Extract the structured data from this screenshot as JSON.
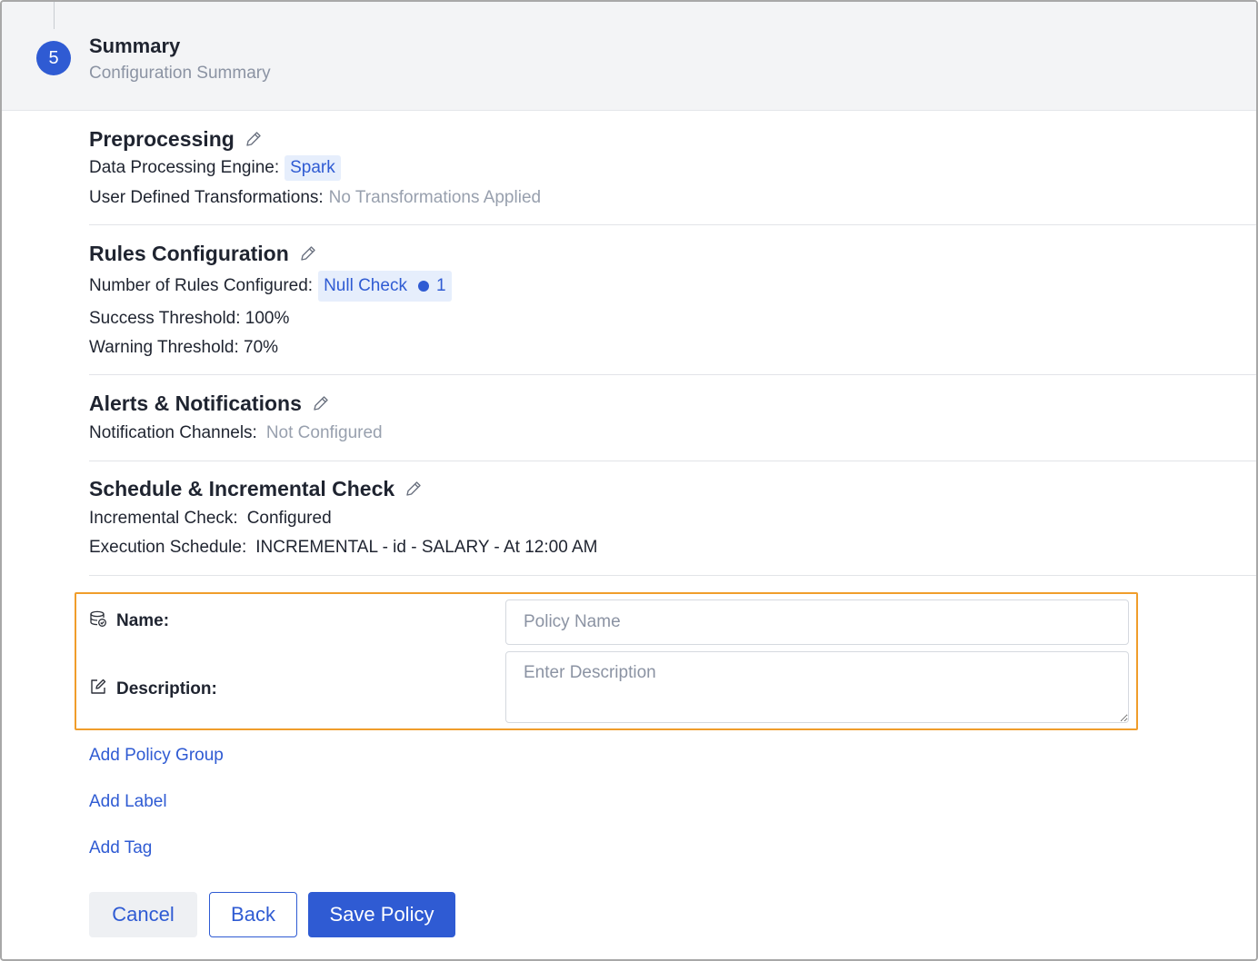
{
  "step": {
    "number": "5",
    "title": "Summary",
    "subtitle": "Configuration Summary"
  },
  "preprocessing": {
    "title": "Preprocessing",
    "engine_label": "Data Processing Engine:",
    "engine_value": "Spark",
    "udt_label": "User Defined Transformations:",
    "udt_value": "No Transformations Applied"
  },
  "rules": {
    "title": "Rules Configuration",
    "count_label": "Number of Rules Configured:",
    "rule_name": "Null Check",
    "rule_count": "1",
    "success_threshold": "Success Threshold: 100%",
    "warning_threshold": "Warning Threshold: 70%"
  },
  "alerts": {
    "title": "Alerts & Notifications",
    "channels_label": "Notification Channels:",
    "channels_value": "Not Configured"
  },
  "schedule": {
    "title": "Schedule & Incremental Check",
    "incremental_label": "Incremental Check:",
    "incremental_value": "Configured",
    "execution_label": "Execution Schedule:",
    "execution_value": "INCREMENTAL - id - SALARY - At 12:00 AM"
  },
  "form": {
    "name_label": "Name:",
    "name_placeholder": "Policy Name",
    "description_label": "Description:",
    "description_placeholder": "Enter Description"
  },
  "links": {
    "policy_group": "Add Policy Group",
    "label": "Add Label",
    "tag": "Add Tag"
  },
  "buttons": {
    "cancel": "Cancel",
    "back": "Back",
    "save": "Save Policy"
  },
  "colors": {
    "accent": "#2f5bd3",
    "highlight": "#f09d2b"
  }
}
